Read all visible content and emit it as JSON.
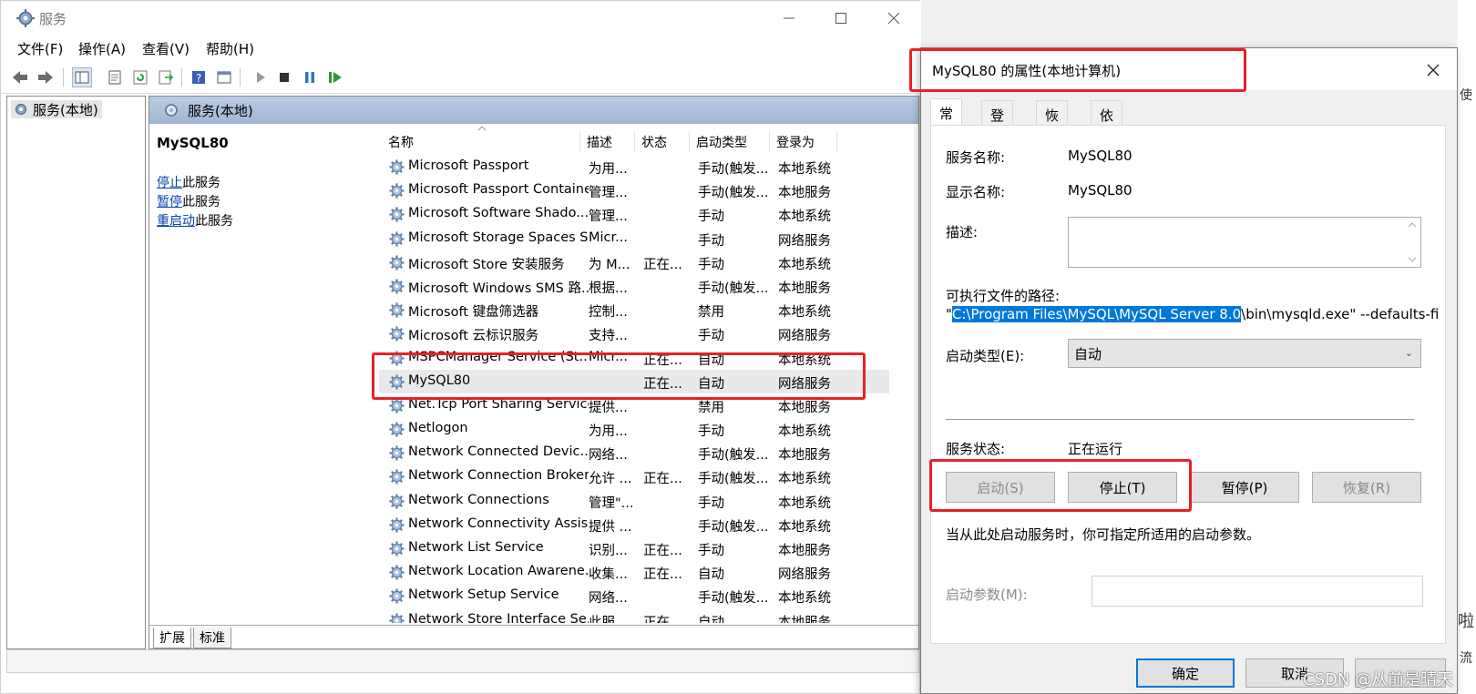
{
  "services_window": {
    "title": "服务",
    "menu": [
      "文件(F)",
      "操作(A)",
      "查看(V)",
      "帮助(H)"
    ],
    "tree_item": "服务(本地)",
    "pane_header": "服务(本地)",
    "selected_service": "MySQL80",
    "actions": [
      {
        "link": "停止",
        "suffix": "此服务"
      },
      {
        "link": "暂停",
        "suffix": "此服务"
      },
      {
        "link": "重启动",
        "suffix": "此服务"
      }
    ],
    "columns": {
      "name": "名称",
      "desc": "描述",
      "state": "状态",
      "start": "启动类型",
      "logon": "登录为"
    },
    "rows": [
      {
        "name": "Microsoft Passport",
        "desc": "为用...",
        "state": "",
        "start": "手动(触发...",
        "logon": "本地系统"
      },
      {
        "name": "Microsoft Passport Container",
        "desc": "管理...",
        "state": "",
        "start": "手动(触发...",
        "logon": "本地服务"
      },
      {
        "name": "Microsoft Software Shado...",
        "desc": "管理...",
        "state": "",
        "start": "手动",
        "logon": "本地系统"
      },
      {
        "name": "Microsoft Storage Spaces S...",
        "desc": "Micr...",
        "state": "",
        "start": "手动",
        "logon": "网络服务"
      },
      {
        "name": "Microsoft Store 安装服务",
        "desc": "为 M...",
        "state": "正在...",
        "start": "手动",
        "logon": "本地系统"
      },
      {
        "name": "Microsoft Windows SMS 路...",
        "desc": "根据...",
        "state": "",
        "start": "手动(触发...",
        "logon": "本地服务"
      },
      {
        "name": "Microsoft 键盘筛选器",
        "desc": "控制...",
        "state": "",
        "start": "禁用",
        "logon": "本地系统"
      },
      {
        "name": "Microsoft 云标识服务",
        "desc": "支持...",
        "state": "",
        "start": "手动",
        "logon": "网络服务"
      },
      {
        "name": "MSPCManager Service (St...",
        "desc": "Micr...",
        "state": "正在...",
        "start": "自动",
        "logon": "本地系统"
      },
      {
        "name": "MySQL80",
        "desc": "",
        "state": "正在...",
        "start": "自动",
        "logon": "网络服务"
      },
      {
        "name": "Net.Tcp Port Sharing Service",
        "desc": "提供...",
        "state": "",
        "start": "禁用",
        "logon": "本地服务"
      },
      {
        "name": "Netlogon",
        "desc": "为用...",
        "state": "",
        "start": "手动",
        "logon": "本地系统"
      },
      {
        "name": "Network Connected Devic...",
        "desc": "网络...",
        "state": "",
        "start": "手动(触发...",
        "logon": "本地服务"
      },
      {
        "name": "Network Connection Broker",
        "desc": "允许 ...",
        "state": "正在...",
        "start": "手动(触发...",
        "logon": "本地系统"
      },
      {
        "name": "Network Connections",
        "desc": "管理\"...",
        "state": "",
        "start": "手动",
        "logon": "本地系统"
      },
      {
        "name": "Network Connectivity Assis...",
        "desc": "提供 ...",
        "state": "",
        "start": "手动(触发...",
        "logon": "本地系统"
      },
      {
        "name": "Network List Service",
        "desc": "识别...",
        "state": "正在...",
        "start": "手动",
        "logon": "本地服务"
      },
      {
        "name": "Network Location Awarene...",
        "desc": "收集...",
        "state": "正在...",
        "start": "自动",
        "logon": "网络服务"
      },
      {
        "name": "Network Setup Service",
        "desc": "网络...",
        "state": "",
        "start": "手动(触发...",
        "logon": "本地系统"
      },
      {
        "name": "Network Store Interface Se...",
        "desc": "此服...",
        "state": "正在...",
        "start": "自动",
        "logon": "本地服务"
      }
    ],
    "bottom_tabs": [
      "扩展",
      "标准"
    ]
  },
  "dialog": {
    "title": "MySQL80 的属性(本地计算机)",
    "tabs": [
      "常规",
      "登录",
      "恢复",
      "依存关系"
    ],
    "service_name_label": "服务名称:",
    "service_name": "MySQL80",
    "display_name_label": "显示名称:",
    "display_name": "MySQL80",
    "description_label": "描述:",
    "path_label": "可执行文件的路径:",
    "path_prefix": "\"",
    "path_selected": "C:\\Program Files\\MySQL\\MySQL Server 8.0",
    "path_rest": "\\bin\\mysqld.exe\" --defaults-file=",
    "startup_type_label": "启动类型(E):",
    "startup_type": "自动",
    "status_label": "服务状态:",
    "status": "正在运行",
    "buttons": {
      "start": "启动(S)",
      "stop": "停止(T)",
      "pause": "暂停(P)",
      "resume": "恢复(R)"
    },
    "hint": "当从此处启动服务时，你可指定所适用的启动参数。",
    "params_label": "启动参数(M):",
    "ok": "确定",
    "cancel": "取消"
  },
  "watermark": "CSDN @从前是晴天",
  "background_fragments": {
    "a": "使",
    "b": "啦",
    "c": "流"
  },
  "colors": {
    "highlight_red": "#e8202a",
    "selection_blue": "#0078d7",
    "link_blue": "#0645ad"
  }
}
